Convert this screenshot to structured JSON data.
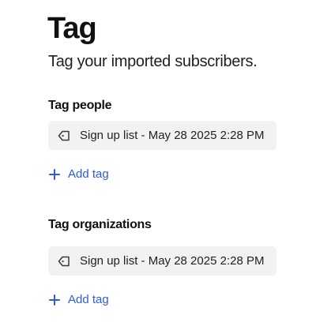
{
  "header": {
    "title": "Tag",
    "subtitle": "Tag your imported subscribers."
  },
  "sections": [
    {
      "title": "Tag people",
      "tags": [
        "Sign up list - May 28 2025 2:28 PM"
      ],
      "add_label": "Add tag"
    },
    {
      "title": "Tag organizations",
      "tags": [
        "Sign up list - May 28 2025 2:28 PM"
      ],
      "add_label": "Add tag"
    }
  ],
  "icons": {
    "tag": "tag-icon",
    "add": "plus-icon"
  },
  "colors": {
    "accent": "#2f5bd6",
    "chip_bg": "#f2f2f2",
    "text": "#1a1a1a"
  }
}
